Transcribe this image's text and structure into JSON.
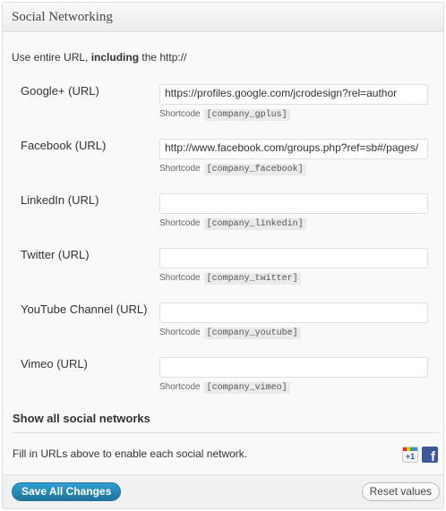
{
  "panel": {
    "title": "Social Networking"
  },
  "intro": {
    "before": "Use entire URL, ",
    "bold": "including",
    "after": " the http://"
  },
  "shortcode_label": "Shortcode",
  "fields": [
    {
      "label": "Google+ (URL)",
      "value": "https://profiles.google.com/jcrodesign?rel=author",
      "shortcode": "[company_gplus]"
    },
    {
      "label": "Facebook (URL)",
      "value": "http://www.facebook.com/groups.php?ref=sb#/pages/",
      "shortcode": "[company_facebook]"
    },
    {
      "label": "LinkedIn (URL)",
      "value": "",
      "shortcode": "[company_linkedin]"
    },
    {
      "label": "Twitter (URL)",
      "value": "",
      "shortcode": "[company_twitter]"
    },
    {
      "label": "YouTube Channel (URL)",
      "value": "",
      "shortcode": "[company_youtube]"
    },
    {
      "label": "Vimeo (URL)",
      "value": "",
      "shortcode": "[company_vimeo]"
    }
  ],
  "show_all": "Show all social networks",
  "hint": "Fill in URLs above to enable each social network.",
  "enabled_icons": {
    "gplus_text": "+1",
    "facebook_text": "f"
  },
  "buttons": {
    "save": "Save All Changes",
    "reset": "Reset values"
  }
}
